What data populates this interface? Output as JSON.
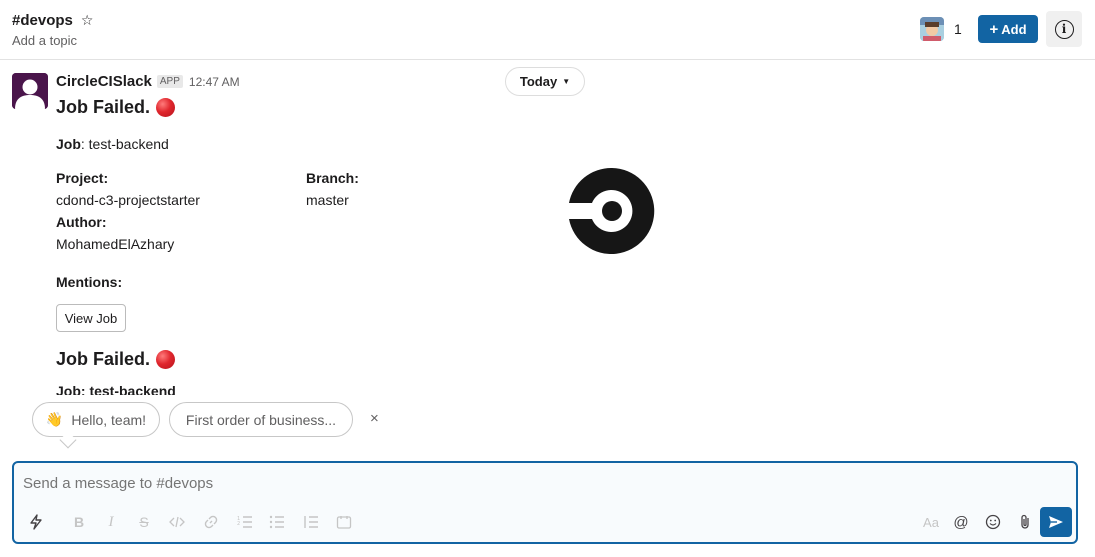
{
  "header": {
    "channel": "#devops",
    "topic": "Add a topic",
    "member_count": "1",
    "add_label": "Add"
  },
  "messages": {
    "today_label": "Today",
    "sender": "CircleCISlack",
    "app_badge": "APP",
    "time": "12:47 AM",
    "job_failed": "Job Failed.",
    "job_label": "Job",
    "job_value": ": test-backend",
    "project_label": "Project:",
    "project_value": "cdond-c3-projectstarter",
    "branch_label": "Branch:",
    "branch_value": "master",
    "author_label": "Author:",
    "author_value": "MohamedElAzhary",
    "mentions_label": "Mentions:",
    "view_job_label": "View Job",
    "job_failed_2": "Job Failed.",
    "cut_text": "Job: test-backend"
  },
  "suggestions": {
    "items": [
      "Hello, team!",
      "First order of business..."
    ],
    "dismiss": "×"
  },
  "composer": {
    "placeholder": "Send a message to #devops",
    "text_style": "Aa"
  },
  "colors": {
    "brand_blue": "#1264a3",
    "error_red": "#e0262d",
    "avatar_purple": "#4a154b"
  },
  "icons": [
    "star-icon",
    "info-icon",
    "lightning-icon",
    "bold-icon",
    "italic-icon",
    "strikethrough-icon",
    "code-icon",
    "link-icon",
    "ordered-list-icon",
    "bulleted-list-icon",
    "blockquote-icon",
    "code-block-icon",
    "mention-icon",
    "emoji-icon",
    "attachment-icon",
    "send-icon"
  ]
}
